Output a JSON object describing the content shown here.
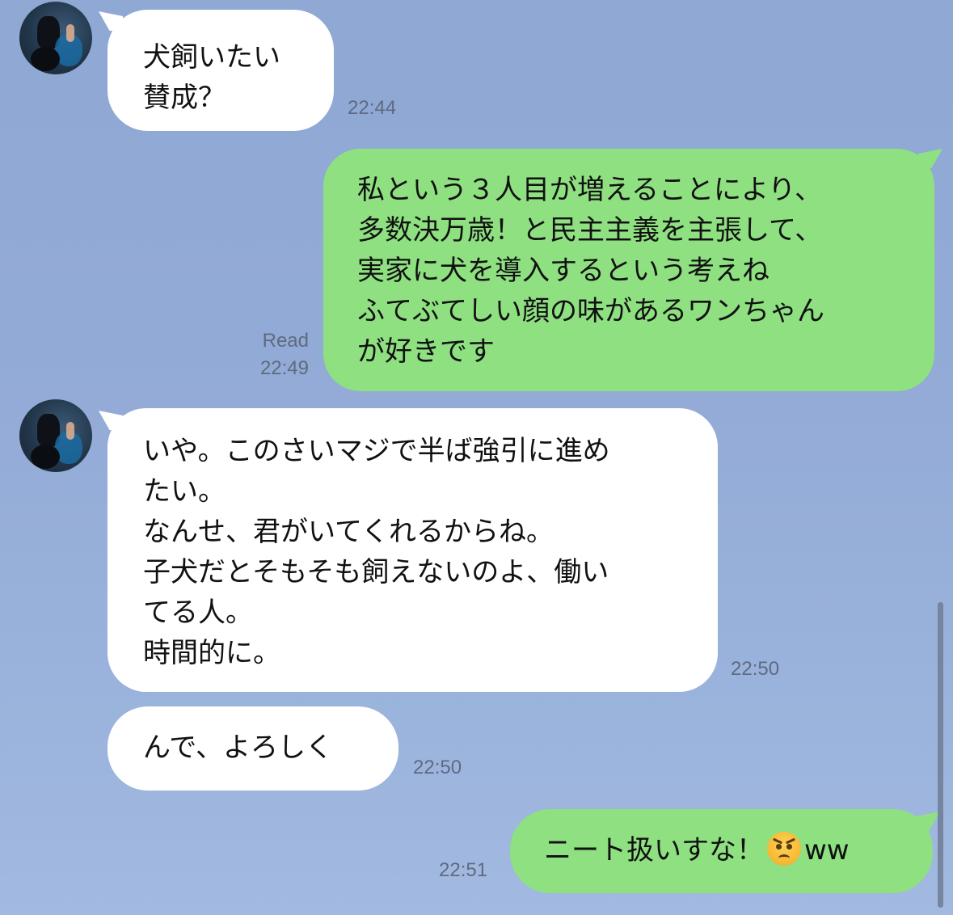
{
  "messages": [
    {
      "sender": "other",
      "avatar": "avatar-photo",
      "lines": [
        "犬飼いたい",
        "賛成？"
      ],
      "time": "22:44"
    },
    {
      "sender": "me",
      "read": "Read",
      "lines": [
        "私という３人目が増えることにより、",
        "多数決万歳！と民主主義を主張して、",
        "実家に犬を導入するという考えね",
        "ふてぶてしい顔の味があるワンちゃん",
        "が好きです"
      ],
      "time": "22:49"
    },
    {
      "sender": "other",
      "avatar": "avatar-photo",
      "lines": [
        "いや。このさいマジで半ば強引に進め",
        "たい。",
        "なんせ、君がいてくれるからね。",
        "子犬だとそもそも飼えないのよ、働い",
        "てる人。",
        "時間的に。"
      ],
      "time": "22:50"
    },
    {
      "sender": "other",
      "lines": [
        "んで、よろしく"
      ],
      "time": "22:50"
    },
    {
      "sender": "me",
      "text_before": "ニート扱いすな！",
      "emoji": "angry-face",
      "text_after": "ww",
      "time": "22:51"
    }
  ],
  "colors": {
    "background": "#93abd6",
    "incoming_bubble": "#ffffff",
    "outgoing_bubble": "#8ee081",
    "timestamp": "#5e6b80"
  }
}
